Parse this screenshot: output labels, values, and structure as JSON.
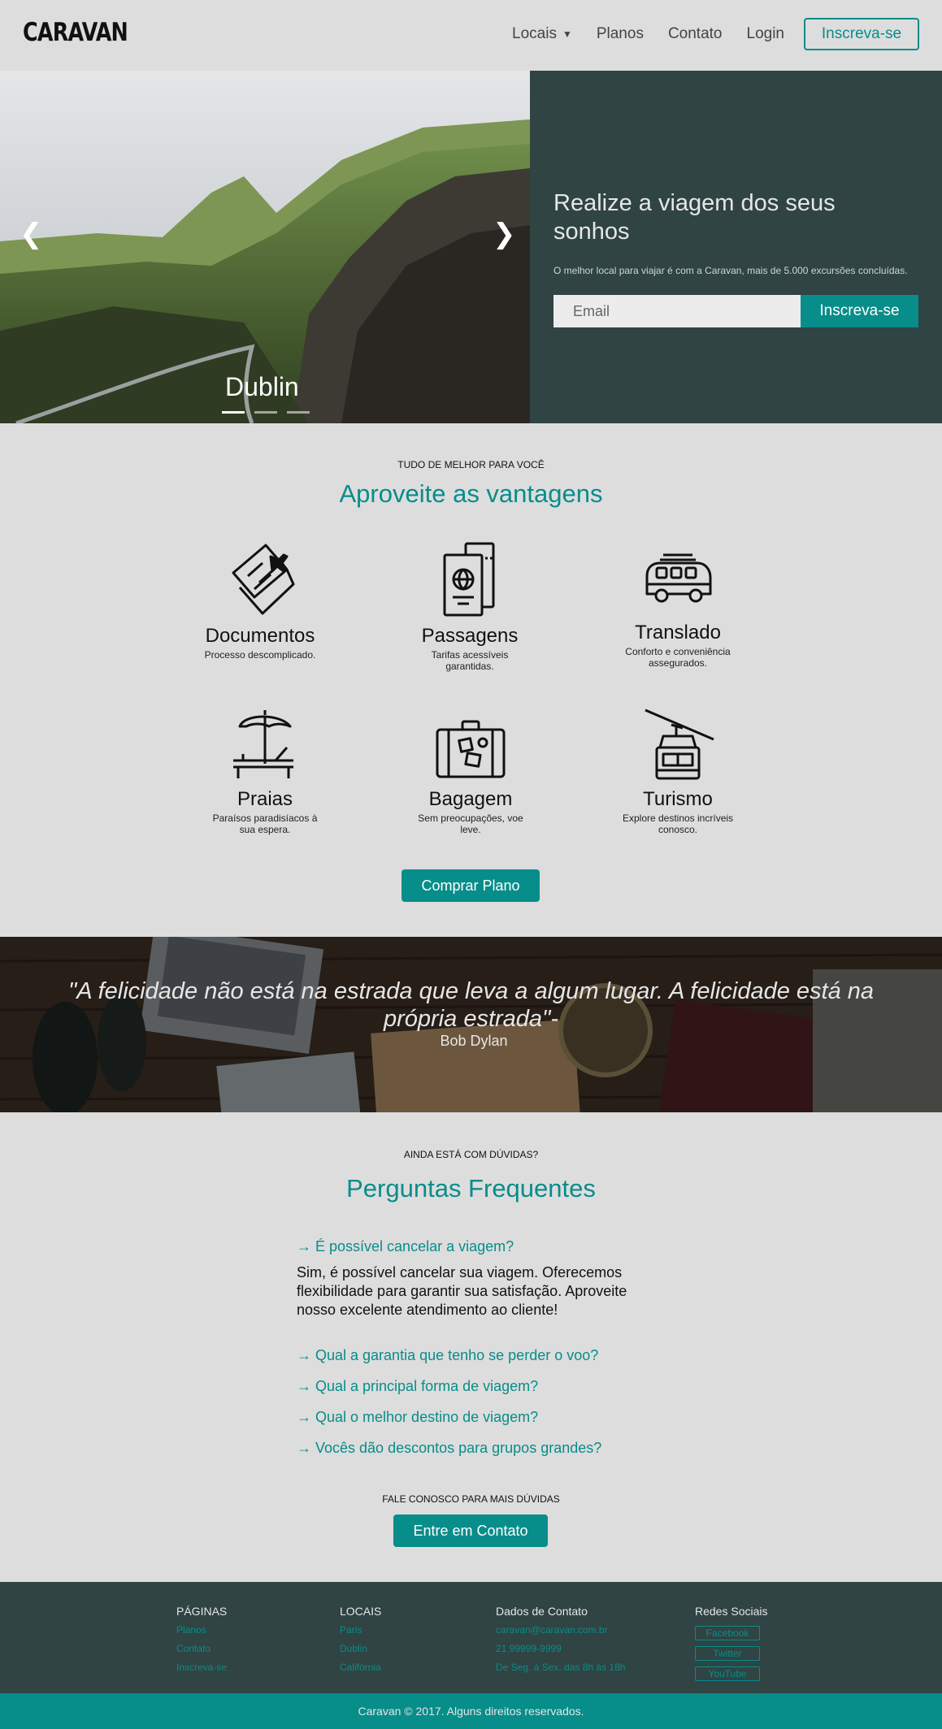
{
  "header": {
    "logo": "CARAVAN",
    "nav": {
      "locais": "Locais",
      "planos": "Planos",
      "contato": "Contato",
      "login": "Login",
      "cta": "Inscreva-se"
    }
  },
  "hero": {
    "slide_caption": "Dublin",
    "title": "Realize a viagem dos seus sonhos",
    "subtitle": "O melhor local para viajar é com a Caravan, mais de 5.000 excursões concluídas.",
    "email_placeholder": "Email",
    "cta": "Inscreva-se"
  },
  "vantagens": {
    "kicker": "TUDO DE MELHOR PARA VOCÊ",
    "title": "Aproveite as vantagens",
    "items": [
      {
        "title": "Documentos",
        "desc": "Processo descomplicado.",
        "icon": "ticket-icon"
      },
      {
        "title": "Passagens",
        "desc": "Tarifas acessíveis garantidas.",
        "icon": "passport-icon"
      },
      {
        "title": "Translado",
        "desc": "Conforto e conveniência assegurados.",
        "icon": "van-icon"
      },
      {
        "title": "Praias",
        "desc": "Paraísos paradisíacos à sua espera.",
        "icon": "beach-icon"
      },
      {
        "title": "Bagagem",
        "desc": "Sem preocupações, voe leve.",
        "icon": "suitcase-icon"
      },
      {
        "title": "Turismo",
        "desc": "Explore destinos incríveis conosco.",
        "icon": "cable-car-icon"
      }
    ],
    "cta": "Comprar Plano"
  },
  "quote": {
    "text": "\"A felicidade não está na estrada que leva a algum lugar. A felicidade está na própria estrada\"-",
    "author": "Bob Dylan"
  },
  "faq": {
    "kicker": "AINDA ESTÁ COM DÚVIDAS?",
    "title": "Perguntas Frequentes",
    "questions": [
      "→ É possível cancelar a viagem?",
      "→ Qual a garantia que tenho se perder o voo?",
      "→ Qual a principal forma de viagem?",
      "→ Qual o melhor destino de viagem?",
      "→ Vocês dão descontos para grupos grandes?"
    ],
    "answer": " Sim, é possível cancelar sua viagem. Oferecemos flexibilidade para garantir sua satisfação. Aproveite nosso excelente atendimento ao cliente!",
    "contact_kicker": "FALE CONOSCO PARA MAIS DÚVIDAS",
    "contact_cta": "Entre em Contato"
  },
  "footer": {
    "paginas": {
      "title": "PÁGINAS",
      "links": [
        "Planos",
        "Contato",
        "Inscreva-se"
      ]
    },
    "locais": {
      "title": "LOCAIS",
      "links": [
        "Paris",
        "Dublin",
        "Califórnia"
      ]
    },
    "contato": {
      "title": "Dados de Contato",
      "lines": [
        "caravan@caravan.com.br",
        "21 99999-9999",
        "De Seg. à Sex. das 8h às 18h"
      ]
    },
    "redes": {
      "title": "Redes Sociais",
      "links": [
        "Facebook",
        "Twitter",
        "YouTube"
      ]
    },
    "copyright": "Caravan © 2017. Alguns direitos reservados."
  },
  "colors": {
    "accent": "#078d8a",
    "dark": "#2f4443",
    "background": "#dddddd"
  }
}
